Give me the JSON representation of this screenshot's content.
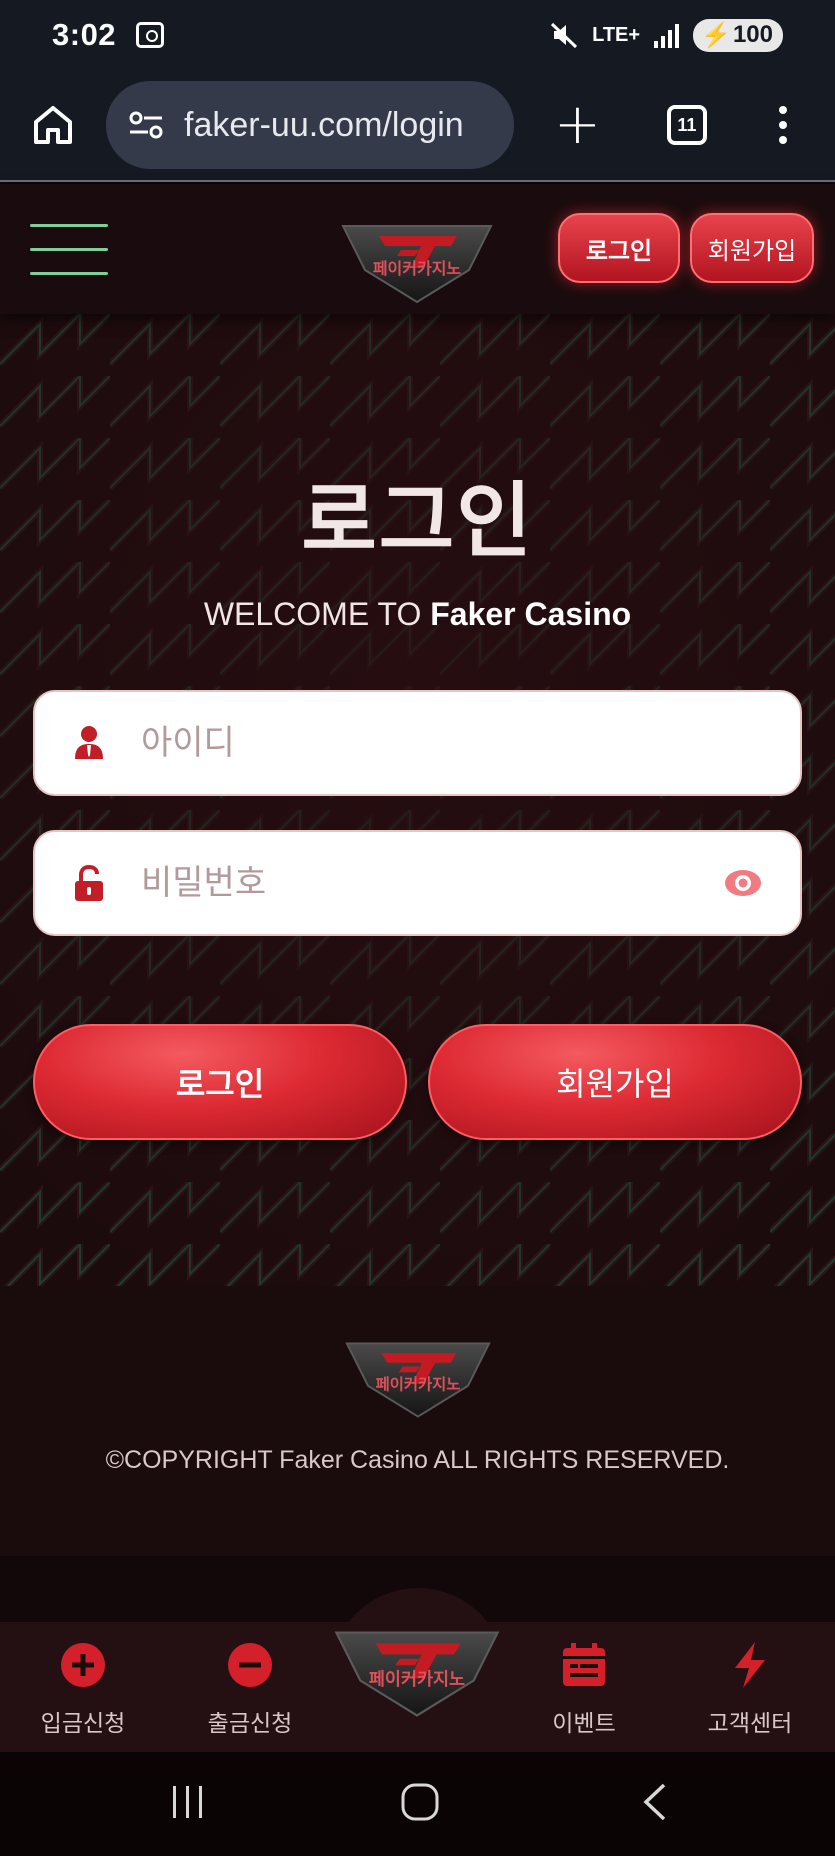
{
  "status_bar": {
    "time": "3:02",
    "network": "LTE+",
    "battery": "100"
  },
  "browser": {
    "url": "faker-uu.com/login",
    "tab_count": "11"
  },
  "header": {
    "logo_text": "페이커카지노",
    "login_label": "로그인",
    "signup_label": "회원가입"
  },
  "login": {
    "title": "로그인",
    "welcome_prefix": "WELCOME TO",
    "welcome_brand": "Faker Casino",
    "id_placeholder": "아이디",
    "pw_placeholder": "비밀번호",
    "login_button": "로그인",
    "signup_button": "회원가입"
  },
  "footer": {
    "logo_text": "페이커카지노",
    "copyright": "©COPYRIGHT Faker Casino ALL RIGHTS RESERVED."
  },
  "bottom_nav": {
    "items": [
      {
        "label": "입금신청",
        "icon": "plus-circle-icon"
      },
      {
        "label": "출금신청",
        "icon": "minus-circle-icon"
      },
      {
        "label": "이벤트",
        "icon": "calendar-icon"
      },
      {
        "label": "고객센터",
        "icon": "lightning-icon"
      }
    ],
    "center_logo_text": "페이커카지노"
  },
  "colors": {
    "accent_red": "#dd2a33",
    "menu_green": "#7fcf9a",
    "background": "#1c0b0d"
  }
}
